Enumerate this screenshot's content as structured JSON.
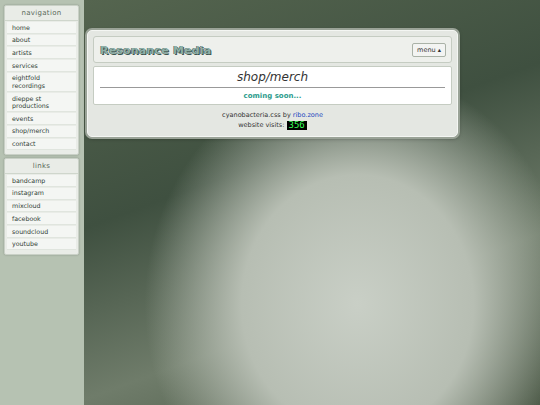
{
  "sidebar": {
    "navigation": {
      "title": "navigation",
      "items": [
        "home",
        "about",
        "artists",
        "services",
        "eightfold recordings",
        "dieppe st productions",
        "events",
        "shop/merch",
        "contact"
      ]
    },
    "links": {
      "title": "links",
      "items": [
        "bandcamp",
        "instagram",
        "mixcloud",
        "facebook",
        "soundcloud",
        "youtube"
      ]
    }
  },
  "header": {
    "title": "Resonance Media",
    "menu_button": "menu ▴"
  },
  "content": {
    "heading": "shop/merch",
    "message": "coming soon..."
  },
  "footer": {
    "credit_prefix": "cyanobacteria.css by",
    "credit_link": "ribo.zone",
    "visits_label": "website visits:",
    "visits": "356"
  }
}
